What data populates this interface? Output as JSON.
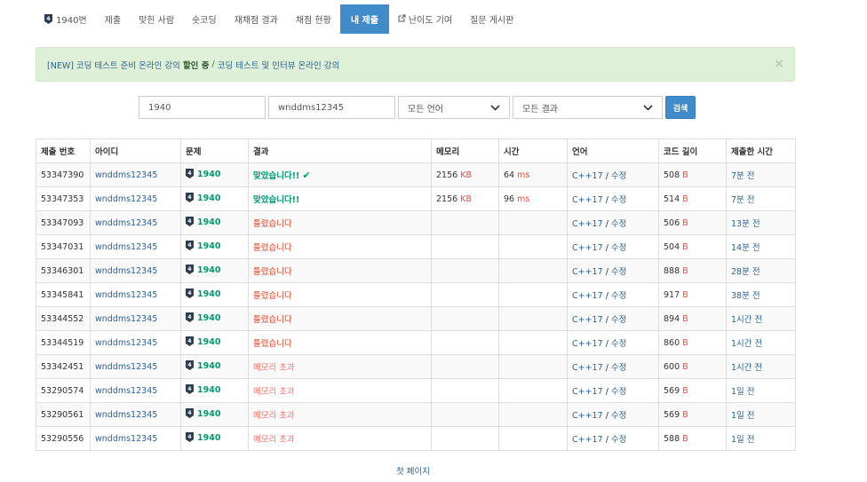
{
  "nav": {
    "problem_tab": "1940번",
    "items": [
      "제출",
      "맞힌 사람",
      "숏코딩",
      "재채점 결과",
      "채점 현황"
    ],
    "active_tab": "내 제출",
    "difficulty_tab": "난이도 기여",
    "board_tab": "질문 게시판"
  },
  "alert": {
    "link1": "[NEW] 코딩 테스트 준비 온라인 강의",
    "highlight": "할인 중",
    "separator": "/",
    "link2": "코딩 테스트 및 인터뷰 온라인 강의",
    "close": "×"
  },
  "filters": {
    "problem_id": "1940",
    "user_id": "wnddms12345",
    "language": "모든 언어",
    "result": "모든 결과",
    "search_label": "검색"
  },
  "table": {
    "headers": [
      "제출 번호",
      "아이디",
      "문제",
      "결과",
      "메모리",
      "시간",
      "언어",
      "코드 길이",
      "제출한 시간"
    ],
    "memory_unit": "KB",
    "time_unit": "ms",
    "length_unit": "B",
    "lang_separator": "/",
    "rows": [
      {
        "id": "53347390",
        "user": "wnddms12345",
        "problem": "1940",
        "result": "맞았습니다!!",
        "result_type": "ac",
        "check": "✔",
        "memory": "2156",
        "time": "64",
        "lang": "C++17",
        "edit": "수정",
        "length": "508",
        "submitted": "7분 전"
      },
      {
        "id": "53347353",
        "user": "wnddms12345",
        "problem": "1940",
        "result": "맞았습니다!!",
        "result_type": "ac",
        "check": "",
        "memory": "2156",
        "time": "96",
        "lang": "C++17",
        "edit": "수정",
        "length": "514",
        "submitted": "7분 전"
      },
      {
        "id": "53347093",
        "user": "wnddms12345",
        "problem": "1940",
        "result": "틀렸습니다",
        "result_type": "wa",
        "check": "",
        "memory": "",
        "time": "",
        "lang": "C++17",
        "edit": "수정",
        "length": "506",
        "submitted": "13분 전"
      },
      {
        "id": "53347031",
        "user": "wnddms12345",
        "problem": "1940",
        "result": "틀렸습니다",
        "result_type": "wa",
        "check": "",
        "memory": "",
        "time": "",
        "lang": "C++17",
        "edit": "수정",
        "length": "504",
        "submitted": "14분 전"
      },
      {
        "id": "53346301",
        "user": "wnddms12345",
        "problem": "1940",
        "result": "틀렸습니다",
        "result_type": "wa",
        "check": "",
        "memory": "",
        "time": "",
        "lang": "C++17",
        "edit": "수정",
        "length": "888",
        "submitted": "28분 전"
      },
      {
        "id": "53345841",
        "user": "wnddms12345",
        "problem": "1940",
        "result": "틀렸습니다",
        "result_type": "wa",
        "check": "",
        "memory": "",
        "time": "",
        "lang": "C++17",
        "edit": "수정",
        "length": "917",
        "submitted": "38분 전"
      },
      {
        "id": "53344552",
        "user": "wnddms12345",
        "problem": "1940",
        "result": "틀렸습니다",
        "result_type": "wa",
        "check": "",
        "memory": "",
        "time": "",
        "lang": "C++17",
        "edit": "수정",
        "length": "894",
        "submitted": "1시간 전"
      },
      {
        "id": "53344519",
        "user": "wnddms12345",
        "problem": "1940",
        "result": "틀렸습니다",
        "result_type": "wa",
        "check": "",
        "memory": "",
        "time": "",
        "lang": "C++17",
        "edit": "수정",
        "length": "860",
        "submitted": "1시간 전"
      },
      {
        "id": "53342451",
        "user": "wnddms12345",
        "problem": "1940",
        "result": "메모리 초과",
        "result_type": "mle",
        "check": "",
        "memory": "",
        "time": "",
        "lang": "C++17",
        "edit": "수정",
        "length": "600",
        "submitted": "1시간 전"
      },
      {
        "id": "53290574",
        "user": "wnddms12345",
        "problem": "1940",
        "result": "메모리 초과",
        "result_type": "mle",
        "check": "",
        "memory": "",
        "time": "",
        "lang": "C++17",
        "edit": "수정",
        "length": "569",
        "submitted": "1일 전"
      },
      {
        "id": "53290561",
        "user": "wnddms12345",
        "problem": "1940",
        "result": "메모리 초과",
        "result_type": "mle",
        "check": "",
        "memory": "",
        "time": "",
        "lang": "C++17",
        "edit": "수정",
        "length": "569",
        "submitted": "1일 전"
      },
      {
        "id": "53290556",
        "user": "wnddms12345",
        "problem": "1940",
        "result": "메모리 초과",
        "result_type": "mle",
        "check": "",
        "memory": "",
        "time": "",
        "lang": "C++17",
        "edit": "수정",
        "length": "588",
        "submitted": "1일 전"
      }
    ]
  },
  "pager": {
    "first_page": "첫 페이지"
  },
  "colors": {
    "accent": "#428bca",
    "accepted": "#009874",
    "wrong": "#dd4124",
    "memory_exceeded": "#fa7268",
    "link": "#2a6496",
    "alert_bg": "#dff0d8",
    "tier_badge": "#2d3e50"
  },
  "icons": {
    "tier": "tier-badge-icon",
    "external": "external-link-icon",
    "caret": "chevron-down-icon",
    "accepted": "check-icon",
    "close": "close-icon"
  }
}
